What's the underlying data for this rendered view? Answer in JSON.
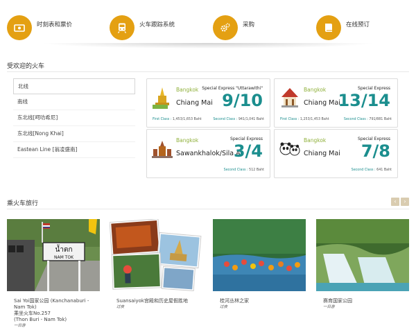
{
  "nav": [
    {
      "label": "时刻表和票价",
      "icon": "ticket-icon"
    },
    {
      "label": "火车跟踪系统",
      "icon": "train-icon"
    },
    {
      "label": "采购",
      "icon": "gears-icon"
    },
    {
      "label": "在线预订",
      "icon": "book-icon"
    }
  ],
  "popular": {
    "title": "受欢迎的火车",
    "routes": [
      "北线",
      "南线",
      "东北线[呵叻希尼]",
      "东北线[Nong Khai]",
      "Eastean Line [翁凌盛南]"
    ],
    "cards": [
      {
        "from": "Bangkok",
        "to": "Chiang Mai",
        "service": "Special Express \"Uttarawithi\"",
        "date": "9/10",
        "first_label": "First Class :",
        "first_price": "1,453/1,653 Baht",
        "second_label": "Second Class :",
        "second_price": "941/1,041 Baht",
        "icon": "temple-icon"
      },
      {
        "from": "Bangkok",
        "to": "Chiang Mai",
        "service": "Special Express",
        "date": "13/14",
        "first_label": "First Class :",
        "first_price": "1,253/1,453 Baht",
        "second_label": "Second Class :",
        "second_price": "791/881 Baht",
        "icon": "pavilion-icon"
      },
      {
        "from": "Bangkok",
        "to": "Sawankhalok/Sila At",
        "service": "Special Express",
        "date": "3/4",
        "first_label": "",
        "first_price": "",
        "second_label": "Second Class :",
        "second_price": "512 Baht",
        "icon": "ruins-icon"
      },
      {
        "from": "Bangkok",
        "to": "Chiang Mai",
        "service": "Special Express",
        "date": "7/8",
        "first_label": "",
        "first_price": "",
        "second_label": "Second Class :",
        "second_price": "641 Baht",
        "icon": "panda-icon"
      }
    ]
  },
  "trips": {
    "title": "乘火车旅行",
    "prev": "‹",
    "next": "›",
    "items": [
      {
        "caption": "Sai Yoi国家公园 (Kanchanaburi - Nam Tok)",
        "caption2": "乘坐火车No.257",
        "caption3": "(Thon Buri - Nam Tok)",
        "sub": "一日游",
        "sign": "น้ำตก",
        "sign2": "NAM TOK"
      },
      {
        "caption": "Suansaiyok宫殿和历史屋假胜地",
        "caption2": "",
        "caption3": "",
        "sub": "过夜"
      },
      {
        "caption": "桂河丛林之家",
        "caption2": "",
        "caption3": "",
        "sub": "过夜"
      },
      {
        "caption": "赛育国家公园",
        "caption2": "",
        "caption3": "",
        "sub": "一日游"
      }
    ]
  }
}
